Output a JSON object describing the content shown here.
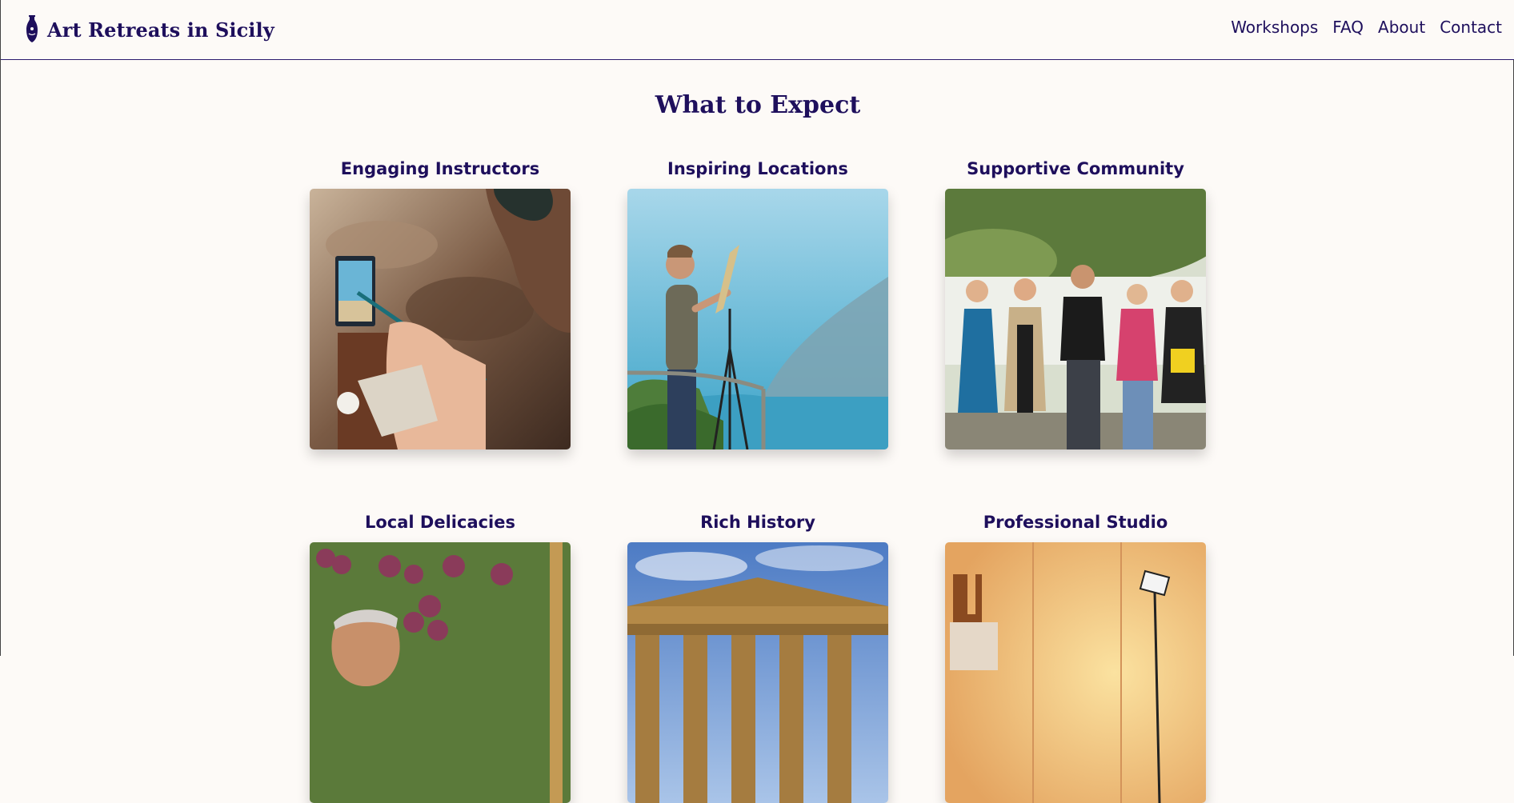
{
  "header": {
    "brand": "Art Retreats in Sicily",
    "brand_icon": "vase-icon",
    "nav": [
      "Workshops",
      "FAQ",
      "About",
      "Contact"
    ]
  },
  "section": {
    "title": "What to Expect",
    "cards": [
      {
        "title": "Engaging Instructors"
      },
      {
        "title": "Inspiring Locations"
      },
      {
        "title": "Supportive Community"
      },
      {
        "title": "Local Delicacies"
      },
      {
        "title": "Rich History"
      },
      {
        "title": "Professional Studio"
      }
    ]
  },
  "colors": {
    "background": "#fdfaf7",
    "accent": "#1e0f5c"
  }
}
